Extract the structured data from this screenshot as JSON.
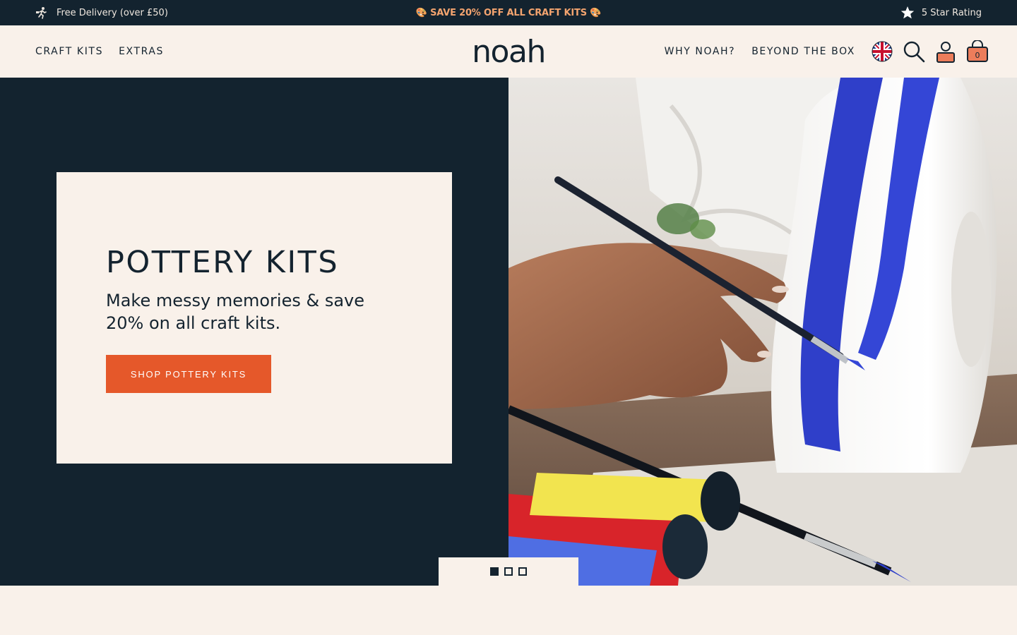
{
  "announcement": {
    "delivery_text": "Free Delivery (over £50)",
    "delivery_icon": "running-courier-icon",
    "promo_text": "🎨 SAVE 20% OFF ALL CRAFT KITS 🎨",
    "rating_text": "5 Star Rating",
    "rating_icon": "star-icon"
  },
  "header": {
    "nav_left": [
      "CRAFT KITS",
      "EXTRAS"
    ],
    "logo": "noah",
    "nav_right": [
      "WHY NOAH?",
      "BEYOND THE BOX"
    ],
    "icons": [
      "uk-flag-icon",
      "search-icon",
      "account-icon",
      "cart-icon"
    ],
    "cart_count": "0"
  },
  "hero": {
    "title": "POTTERY KITS",
    "subtitle": "Make messy memories & save 20% on all craft kits.",
    "cta_label": "SHOP POTTERY KITS",
    "image_alt": "Hand painting blue stripes on a white clay vase",
    "slides_total": 3,
    "slide_active": 1
  },
  "colors": {
    "navy": "#13232f",
    "cream": "#f9f1ea",
    "accent": "#e5582a",
    "promo": "#f4a46f"
  }
}
